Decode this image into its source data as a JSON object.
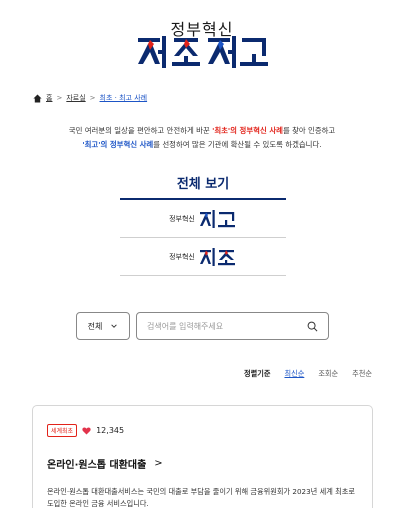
{
  "logo": {
    "subtitle": "정부혁신",
    "main_text": "최초최고",
    "colors": {
      "navy": "#0b2a6f",
      "red": "#e2231a",
      "blue": "#1d55c6"
    }
  },
  "breadcrumb": {
    "home": "홈",
    "items": [
      "자료실",
      "최초 · 최고 사례"
    ],
    "separator": ">"
  },
  "intro": {
    "line1_pre": "국민 여러분의 일상을 편안하고 안전하게 바꾼 ",
    "line1_red": "'최초'의 정부혁신 사례",
    "line1_post": "를 찾아 인증하고",
    "line2_blue": "'최고'의 정부혁신 사례",
    "line2_post": "를 선정하여 많은 기관에 확산될 수 있도록 하겠습니다."
  },
  "menu": {
    "title": "전체 보기",
    "items": [
      {
        "small": "정부혁신",
        "big": "최고"
      },
      {
        "small": "정부혁신",
        "big": "최초"
      }
    ]
  },
  "search": {
    "category": "전체",
    "placeholder": "검색어를 입력해주세요",
    "value": ""
  },
  "sort": {
    "label": "정렬기준",
    "options": [
      "최신순",
      "조회순",
      "추천순"
    ],
    "active": "최신순"
  },
  "cards": [
    {
      "badge": "세계최초",
      "likes": "12,345",
      "title": "온라인·원스톱 대환대출",
      "arrow": ">",
      "desc": "온라인·원스톱 대환대출서비스는 국민의 대출로 부담을 줄이기 위해 금융위원회가 2023년 세계 최초로 도입한 온라인 금융 서비스입니다."
    }
  ],
  "icons": {
    "home": "home-icon",
    "chevron": "chevron-down-icon",
    "search": "search-icon",
    "heart": "heart-icon"
  }
}
